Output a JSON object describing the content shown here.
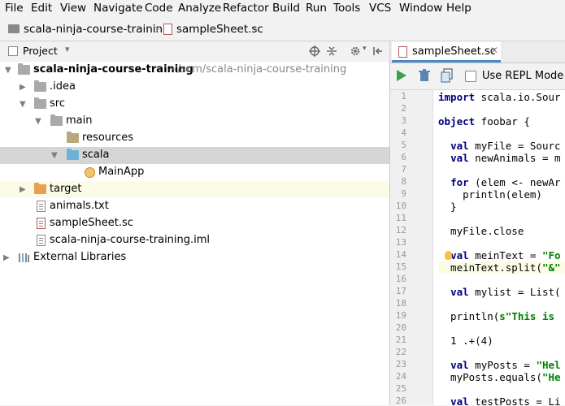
{
  "menu": [
    "File",
    "Edit",
    "View",
    "Navigate",
    "Code",
    "Analyze",
    "Refactor",
    "Build",
    "Run",
    "Tools",
    "VCS",
    "Window",
    "Help"
  ],
  "breadcrumb": {
    "project": "scala-ninja-course-training",
    "file": "sampleSheet.sc"
  },
  "project_panel": {
    "title": "Project",
    "tree": [
      {
        "label": "scala-ninja-course-training",
        "path": "~/scm/scala-ninja-course-training"
      },
      {
        "label": ".idea"
      },
      {
        "label": "src"
      },
      {
        "label": "main"
      },
      {
        "label": "resources"
      },
      {
        "label": "scala"
      },
      {
        "label": "MainApp"
      },
      {
        "label": "target"
      },
      {
        "label": "animals.txt"
      },
      {
        "label": "sampleSheet.sc"
      },
      {
        "label": "scala-ninja-course-training.iml"
      },
      {
        "label": "External Libraries"
      }
    ]
  },
  "editor": {
    "tab_label": "sampleSheet.sc",
    "repl_label": "Use REPL Mode (E",
    "line_numbers": [
      "1",
      "2",
      "3",
      "4",
      "5",
      "6",
      "7",
      "8",
      "9",
      "10",
      "11",
      "12",
      "13",
      "14",
      "15",
      "16",
      "17",
      "18",
      "19",
      "20",
      "21",
      "22",
      "23",
      "24",
      "25",
      "26"
    ],
    "code_lines": [
      "import scala.io.Sour",
      "",
      "object foobar {",
      "",
      "  val myFile = Sourc",
      "  val newAnimals = m",
      "",
      "  for (elem <- newAr",
      "    println(elem)",
      "  }",
      "",
      "  myFile.close",
      "",
      "  val meinText = \"Fo",
      "  meinText.split(\"&\"",
      "",
      "  val mylist = List(",
      "",
      "  println(s\"This is ",
      "",
      "  1 .+(4)",
      "",
      "  val myPosts = \"Hel",
      "  myPosts.equals(\"He",
      "",
      "  val testPosts = Li"
    ]
  }
}
